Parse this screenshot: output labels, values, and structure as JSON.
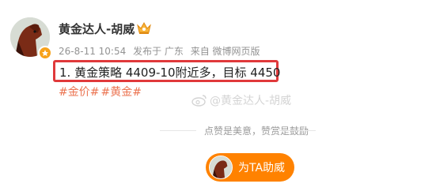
{
  "author": {
    "name": "黄金达人-胡威",
    "avatar_icon": "horse-avatar",
    "badge_icon": "vip-badge-icon",
    "title_icon": "crown-icon"
  },
  "meta": {
    "time": "26-8-11 10:54",
    "location": "发布于 广东",
    "source": "来自 微博网页版"
  },
  "post": {
    "text": "1. 黄金策略 4409-10附近多，目标 4450",
    "hashtags": [
      "#金价#",
      "#黄金#"
    ],
    "highlight_color": "#e0393b"
  },
  "watermark": {
    "text": "@黄金达人-胡威",
    "icon": "weibo-logo-icon"
  },
  "reward": {
    "hint": "点赞是美意，赞赏是鼓励",
    "button_label": "为TA助威",
    "button_color": "#ff8200"
  }
}
